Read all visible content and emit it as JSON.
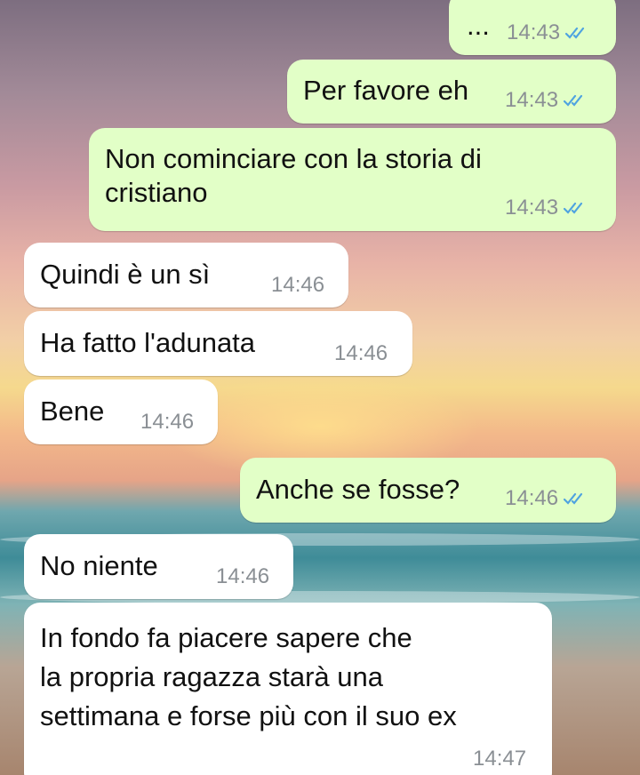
{
  "messages": [
    {
      "text": "...",
      "time": "14:43",
      "direction": "outgoing",
      "status": "read"
    },
    {
      "text": "Per favore eh",
      "time": "14:43",
      "direction": "outgoing",
      "status": "read"
    },
    {
      "text": "Non cominciare con la storia di\ncristiano",
      "time": "14:43",
      "direction": "outgoing",
      "status": "read"
    },
    {
      "text": "Quindi è un sì",
      "time": "14:46",
      "direction": "incoming"
    },
    {
      "text": "Ha fatto l'adunata",
      "time": "14:46",
      "direction": "incoming"
    },
    {
      "text": "Bene",
      "time": "14:46",
      "direction": "incoming"
    },
    {
      "text": "Anche se fosse?",
      "time": "14:46",
      "direction": "outgoing",
      "status": "read"
    },
    {
      "text": "No niente",
      "time": "14:46",
      "direction": "incoming"
    },
    {
      "text": "In fondo fa piacere sapere che\nla propria ragazza starà una\nsettimana e forse più con il suo ex",
      "time": "14:47",
      "direction": "incoming"
    }
  ],
  "colors": {
    "outgoing_bubble": "#e2ffc7",
    "incoming_bubble": "#ffffff",
    "read_ticks": "#4fa3e0",
    "meta_text": "#8a8f94"
  },
  "icons": {
    "read_status": "double-check-icon"
  }
}
